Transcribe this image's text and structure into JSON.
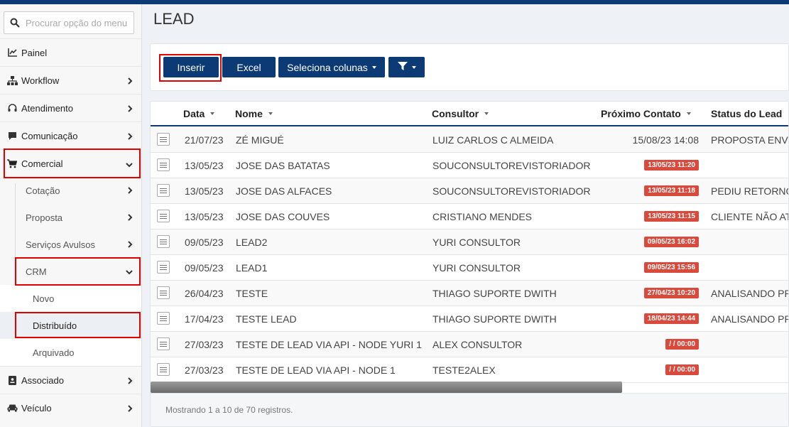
{
  "search": {
    "placeholder": "Procurar opção do menu"
  },
  "sidebar": {
    "items": [
      {
        "label": "Painel",
        "icon": "chart-line-icon"
      },
      {
        "label": "Workflow",
        "icon": "sitemap-icon"
      },
      {
        "label": "Atendimento",
        "icon": "headset-icon"
      },
      {
        "label": "Comunicação",
        "icon": "comment-icon"
      },
      {
        "label": "Comercial",
        "icon": "cart-icon"
      },
      {
        "label": "Associado",
        "icon": "id-card-icon"
      },
      {
        "label": "Veículo",
        "icon": "car-icon"
      }
    ],
    "comercial_sub": [
      "Cotação",
      "Proposta",
      "Serviços Avulsos",
      "CRM"
    ],
    "crm_sub": [
      "Novo",
      "Distribuído",
      "Arquivado"
    ]
  },
  "page": {
    "title": "LEAD"
  },
  "toolbar": {
    "insert_label": "Inserir",
    "excel_label": "Excel",
    "columns_label": "Seleciona colunas",
    "filter_icon": "filter-icon"
  },
  "table": {
    "headers": {
      "data": "Data",
      "nome": "Nome",
      "consultor": "Consultor",
      "proximo": "Próximo Contato",
      "status": "Status do Lead"
    },
    "rows": [
      {
        "data": "21/07/23",
        "nome": "ZÉ MIGUÉ",
        "consultor": "LUIZ CARLOS C ALMEIDA",
        "proximo": "15/08/23 14:08",
        "overdue": false,
        "status": "PROPOSTA ENVI"
      },
      {
        "data": "13/05/23",
        "nome": "JOSE DAS BATATAS",
        "consultor": "SOUCONSULTOREVISTORIADOR",
        "proximo": "13/05/23 11:20",
        "overdue": true,
        "status": ""
      },
      {
        "data": "13/05/23",
        "nome": "JOSE DAS ALFACES",
        "consultor": "SOUCONSULTOREVISTORIADOR",
        "proximo": "13/05/23 11:18",
        "overdue": true,
        "status": "PEDIU RETORNO"
      },
      {
        "data": "13/05/23",
        "nome": "JOSE DAS COUVES",
        "consultor": "CRISTIANO MENDES",
        "proximo": "13/05/23 11:15",
        "overdue": true,
        "status": "CLIENTE NÃO AT"
      },
      {
        "data": "09/05/23",
        "nome": "LEAD2",
        "consultor": "YURI CONSULTOR",
        "proximo": "09/05/23 16:02",
        "overdue": true,
        "status": ""
      },
      {
        "data": "09/05/23",
        "nome": "LEAD1",
        "consultor": "YURI CONSULTOR",
        "proximo": "09/05/23 15:56",
        "overdue": true,
        "status": ""
      },
      {
        "data": "26/04/23",
        "nome": "TESTE",
        "consultor": "THIAGO SUPORTE DWITH",
        "proximo": "27/04/23 10:20",
        "overdue": true,
        "status": "ANALISANDO PR"
      },
      {
        "data": "17/04/23",
        "nome": "TESTE LEAD",
        "consultor": "THIAGO SUPORTE DWITH",
        "proximo": "18/04/23 14:44",
        "overdue": true,
        "status": "ANALISANDO PR"
      },
      {
        "data": "27/03/23",
        "nome": "TESTE DE LEAD VIA API - NODE YURI 1",
        "consultor": "ALEX CONSULTOR",
        "proximo": "/ / 00:00",
        "overdue": true,
        "status": ""
      },
      {
        "data": "27/03/23",
        "nome": "TESTE DE LEAD VIA API - NODE 1",
        "consultor": "TESTE2ALEX",
        "proximo": "/ / 00:00",
        "overdue": true,
        "status": ""
      }
    ]
  },
  "footer": {
    "text": "Mostrando 1 a 10 de 70 registros."
  },
  "colors": {
    "primary": "#0b3a75",
    "danger": "#d94a3c",
    "highlight": "#e00000"
  }
}
